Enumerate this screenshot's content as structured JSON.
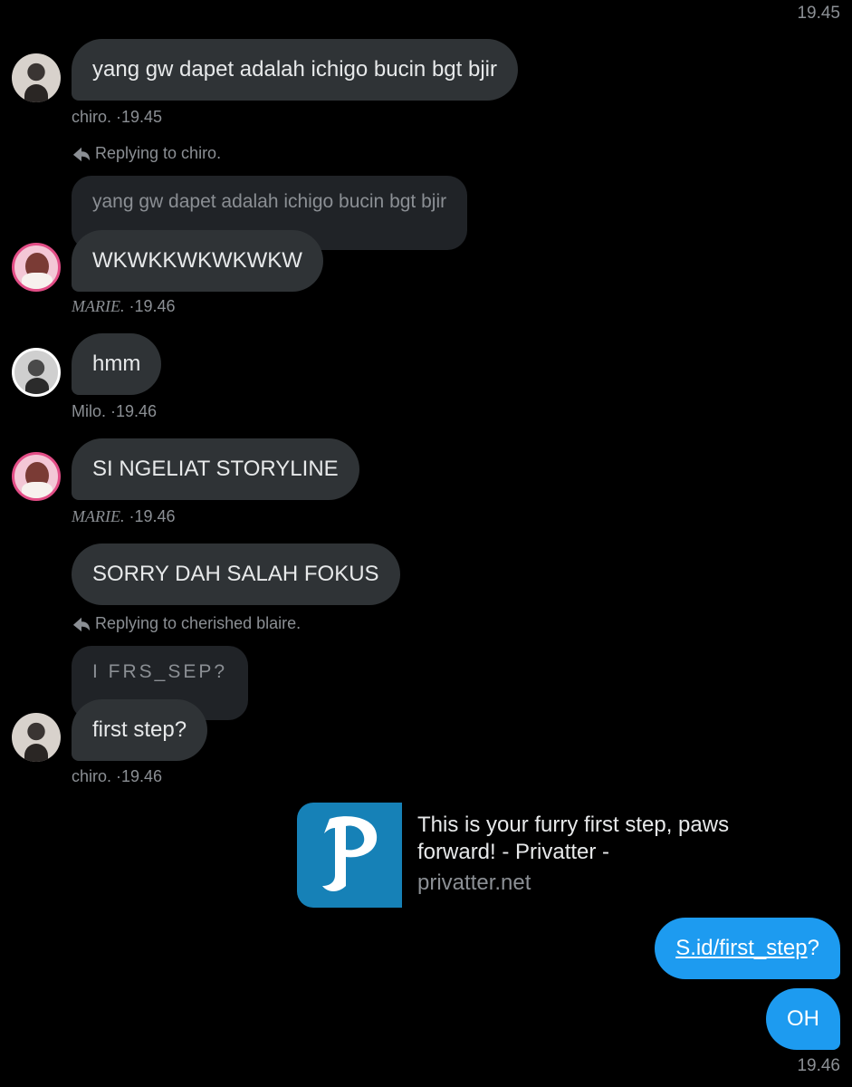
{
  "top_time": "19.45",
  "messages": {
    "m1": {
      "text": "yang gw dapet adalah ichigo bucin bgt bjir",
      "sender": "chiro.",
      "time": "·19.45"
    },
    "m2": {
      "reply_label": "Replying to chiro.",
      "quote": "yang gw dapet adalah ichigo bucin bgt bjir",
      "text": "WKWKKWKWKWKW",
      "sender": "MARIE.",
      "time": "·19.46"
    },
    "m3": {
      "text": "hmm",
      "sender": "Milo.",
      "time": "·19.46"
    },
    "m4": {
      "text": "SI NGELIAT STORYLINE",
      "sender": "MARIE.",
      "time": "·19.46"
    },
    "m5": {
      "text": "SORRY DAH SALAH FOKUS"
    },
    "m6": {
      "reply_label": "Replying to cherished blaire.",
      "quote": "I FRS_SEP?",
      "text": "first step?",
      "sender": "chiro.",
      "time": "·19.46"
    }
  },
  "link_card": {
    "title": "This is your furry first step, paws forward! - Privatter -",
    "domain": "privatter.net",
    "logo_letter": "P",
    "logo_color": "#1681b7"
  },
  "own": {
    "link_text": "S.id/first_step",
    "link_suffix": "?",
    "oh": "OH",
    "time": "19.46"
  },
  "colors": {
    "bubble": "#2f3336",
    "own_bubble": "#1d9bf0",
    "muted": "#8b8f94"
  }
}
